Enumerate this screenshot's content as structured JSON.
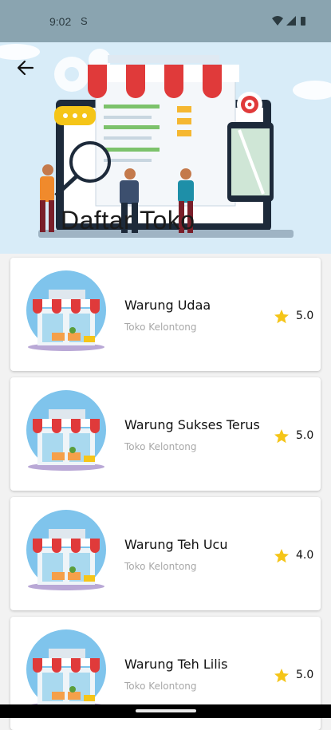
{
  "status": {
    "time": "9:02",
    "s_icon": "S"
  },
  "header": {
    "title": "Daftar Toko"
  },
  "stores": [
    {
      "name": "Warung Udaa",
      "category": "Toko Kelontong",
      "rating": "5.0"
    },
    {
      "name": "Warung Sukses Terus",
      "category": "Toko Kelontong",
      "rating": "5.0"
    },
    {
      "name": "Warung Teh Ucu",
      "category": "Toko Kelontong",
      "rating": "4.0"
    },
    {
      "name": "Warung Teh Lilis",
      "category": "Toko Kelontong",
      "rating": "5.0"
    }
  ],
  "colors": {
    "status_bar": "#8aa4b0",
    "header_bg": "#d8ecf8",
    "star": "#f5c518",
    "awning_red": "#e03a3a"
  },
  "icons": {
    "back": "arrow-left-icon",
    "star": "star-icon",
    "wifi": "wifi-icon",
    "signal": "signal-icon",
    "battery": "battery-icon"
  }
}
